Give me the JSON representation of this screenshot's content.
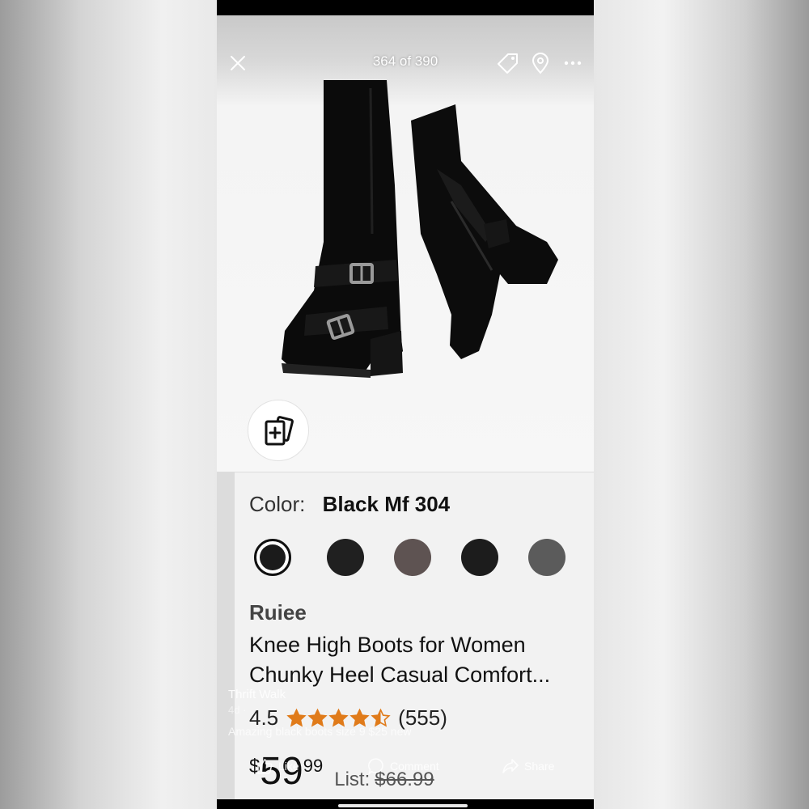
{
  "viewer": {
    "counter": "364 of 390",
    "icons": [
      "close-icon",
      "tag-icon",
      "location-pin-icon",
      "more-icon",
      "add-photo-icon"
    ]
  },
  "product": {
    "color_label": "Color:",
    "color_value": "Black Mf 304",
    "swatches": [
      "#1b1b1b",
      "#202020",
      "#5e5352",
      "#1c1c1c",
      "#5b5b5b"
    ],
    "selected_swatch": 0,
    "brand": "Ruiee",
    "title_line1": "Knee High Boots for Women",
    "title_line2": "Chunky Heel Casual Comfort...",
    "rating": "4.5",
    "rating_stars": 4.5,
    "review_count": "(555)",
    "star_color": "#e07b1a",
    "price_currency": "$",
    "price_whole": "59",
    "price_cents": "99",
    "list_label": "List:",
    "list_price": "$66.99"
  },
  "post": {
    "poster": "Thrift Walk",
    "meta": "4d ·",
    "caption": "Amazing black boots size 9 $25 new",
    "like_label": "Like",
    "comment_label": "Comment",
    "share_label": "Share"
  }
}
